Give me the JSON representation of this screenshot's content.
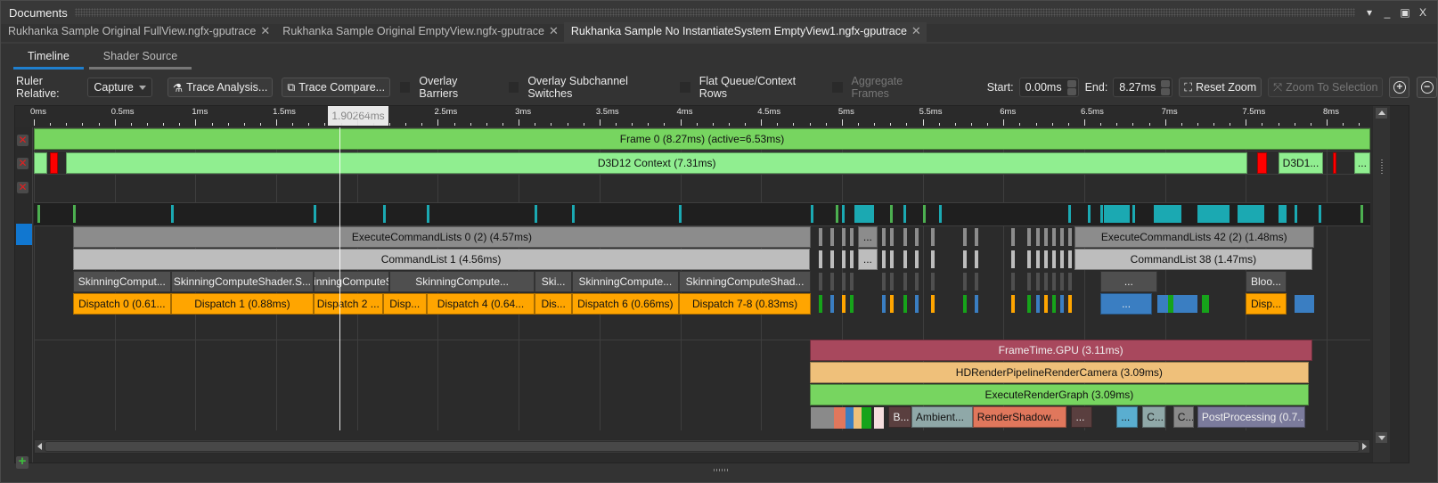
{
  "panel": {
    "title": "Documents",
    "controls": [
      "▾",
      "_",
      "▣",
      "X"
    ]
  },
  "document_tabs": [
    {
      "label": "Rukhanka Sample Original FullView.ngfx-gputrace",
      "active": false
    },
    {
      "label": "Rukhanka Sample Original EmptyView.ngfx-gputrace",
      "active": false
    },
    {
      "label": "Rukhanka Sample No InstantiateSystem EmptyView1.ngfx-gputrace",
      "active": true
    }
  ],
  "sub_tabs": [
    {
      "label": "Timeline",
      "active": true
    },
    {
      "label": "Shader Source",
      "active": false
    }
  ],
  "toolbar": {
    "ruler_relative_label": "Ruler Relative:",
    "ruler_relative_value": "Capture",
    "trace_analysis": "Trace Analysis...",
    "trace_compare": "Trace Compare...",
    "overlay_barriers": "Overlay Barriers",
    "overlay_subchannel": "Overlay Subchannel Switches",
    "flat_queue": "Flat Queue/Context Rows",
    "aggregate_frames": "Aggregate Frames",
    "start_label": "Start:",
    "start_value": "0.00ms",
    "end_label": "End:",
    "end_value": "8.27ms",
    "reset_zoom": "Reset Zoom",
    "zoom_to_selection": "Zoom To Selection"
  },
  "ruler": {
    "range_ms": [
      0,
      8.27
    ],
    "ticks": [
      "0ms",
      "0.5ms",
      "1ms",
      "1.5ms",
      "2ms",
      "2.5ms",
      "3ms",
      "3.5ms",
      "4ms",
      "4.5ms",
      "5ms",
      "5.5ms",
      "6ms",
      "6.5ms",
      "7ms",
      "7.5ms",
      "8ms"
    ],
    "cursor_label": "1.90264ms",
    "cursor_ms": 1.90264
  },
  "colors": {
    "frame": "#77d560",
    "context": "#90ee90",
    "red": "#ff0000",
    "ecl": "#8c8c8c",
    "cmdlist": "#bdbdbd",
    "marker": "#4f4f4f",
    "dispatch": "#ffa500",
    "blue": "#3a7ec2",
    "green": "#16a31a",
    "teal": "#1ba9b2",
    "frametime": "#a8485d",
    "hdrp": "#efc07a",
    "erg": "#77d560",
    "cyanblock": "#5aaed0"
  },
  "rows": {
    "frame": {
      "label": "Frame 0 (8.27ms) (active=6.53ms)",
      "start": 0,
      "end": 8.27
    },
    "context": [
      {
        "label": "",
        "start": 0,
        "end": 0.08
      },
      {
        "label": "D3D12 Context (7.31ms)",
        "start": 0.2,
        "end": 7.51
      },
      {
        "label": "D3D1...",
        "start": 7.7,
        "end": 7.98
      },
      {
        "label": "...",
        "start": 8.17,
        "end": 8.27
      }
    ],
    "context_red": [
      {
        "start": 0.1,
        "end": 0.15
      },
      {
        "start": 7.57,
        "end": 7.63
      },
      {
        "start": 8.04,
        "end": 8.06
      }
    ],
    "ecl": [
      {
        "label": "ExecuteCommandLists 0 (2) (4.57ms)",
        "start": 0.24,
        "end": 4.81
      },
      {
        "label": "...",
        "start": 5.1,
        "end": 5.22
      },
      {
        "label": "ExecuteCommandLists 42 (2) (1.48ms)",
        "start": 6.44,
        "end": 7.92
      }
    ],
    "cmdlist": [
      {
        "label": "CommandList 1 (4.56ms)",
        "start": 0.24,
        "end": 4.8
      },
      {
        "label": "...",
        "start": 5.1,
        "end": 5.22
      },
      {
        "label": "CommandList 38 (1.47ms)",
        "start": 6.44,
        "end": 7.91
      }
    ],
    "markers": [
      {
        "label": "SkinningComput...",
        "start": 0.24,
        "end": 0.85
      },
      {
        "label": "SkinningComputeShader.S...",
        "start": 0.85,
        "end": 1.73
      },
      {
        "label": "SkinningComputeS...",
        "start": 1.73,
        "end": 2.2
      },
      {
        "label": "SkinningCompute...",
        "start": 2.2,
        "end": 3.1
      },
      {
        "label": "Ski...",
        "start": 3.1,
        "end": 3.33
      },
      {
        "label": "SkinningCompute...",
        "start": 3.33,
        "end": 3.99
      },
      {
        "label": "SkinningComputeShad...",
        "start": 3.99,
        "end": 4.81
      },
      {
        "label": "...",
        "start": 6.6,
        "end": 6.95
      },
      {
        "label": "Bloo...",
        "start": 7.5,
        "end": 7.75
      }
    ],
    "dispatches": [
      {
        "label": "Dispatch 0 (0.61...",
        "start": 0.24,
        "end": 0.85
      },
      {
        "label": "Dispatch 1 (0.88ms)",
        "start": 0.85,
        "end": 1.73
      },
      {
        "label": "Dispatch 2 ...",
        "start": 1.73,
        "end": 2.16
      },
      {
        "label": "Disp...",
        "start": 2.16,
        "end": 2.43
      },
      {
        "label": "Dispatch 4 (0.64...",
        "start": 2.43,
        "end": 3.1
      },
      {
        "label": "Dis...",
        "start": 3.1,
        "end": 3.33
      },
      {
        "label": "Dispatch 6 (0.66ms)",
        "start": 3.33,
        "end": 3.99
      },
      {
        "label": "Dispatch 7-8 (0.83ms)",
        "start": 3.99,
        "end": 4.81
      },
      {
        "label": "...",
        "start": 6.6,
        "end": 6.92,
        "color": "blue"
      },
      {
        "label": "Disp...",
        "start": 7.5,
        "end": 7.75
      }
    ],
    "frametime": {
      "label": "FrameTime.GPU (3.11ms)",
      "start": 4.8,
      "end": 7.91
    },
    "hdrp": {
      "label": "HDRenderPipelineRenderCamera (3.09ms)",
      "start": 4.8,
      "end": 7.89
    },
    "erg": {
      "label": "ExecuteRenderGraph (3.09ms)",
      "start": 4.8,
      "end": 7.89
    },
    "passes": [
      {
        "label": "B...",
        "start": 5.29,
        "end": 5.43,
        "color": "#5a3f3f"
      },
      {
        "label": "Ambient...",
        "start": 5.43,
        "end": 5.81,
        "color": "#8fa8a8"
      },
      {
        "label": "RenderShadow...",
        "start": 5.81,
        "end": 6.39,
        "color": "#e0775c"
      },
      {
        "label": "...",
        "start": 6.42,
        "end": 6.55,
        "color": "#5a3f3f"
      },
      {
        "label": "...",
        "start": 6.7,
        "end": 6.83,
        "color": "#5aaed0"
      },
      {
        "label": "C...",
        "start": 6.86,
        "end": 7.0,
        "color": "#8fa8a8"
      },
      {
        "label": "C...",
        "start": 7.05,
        "end": 7.18,
        "color": "#8a8a8a"
      },
      {
        "label": "PostProcessing (0.7...",
        "start": 7.2,
        "end": 7.87,
        "color": "#7b7b9c"
      }
    ]
  }
}
